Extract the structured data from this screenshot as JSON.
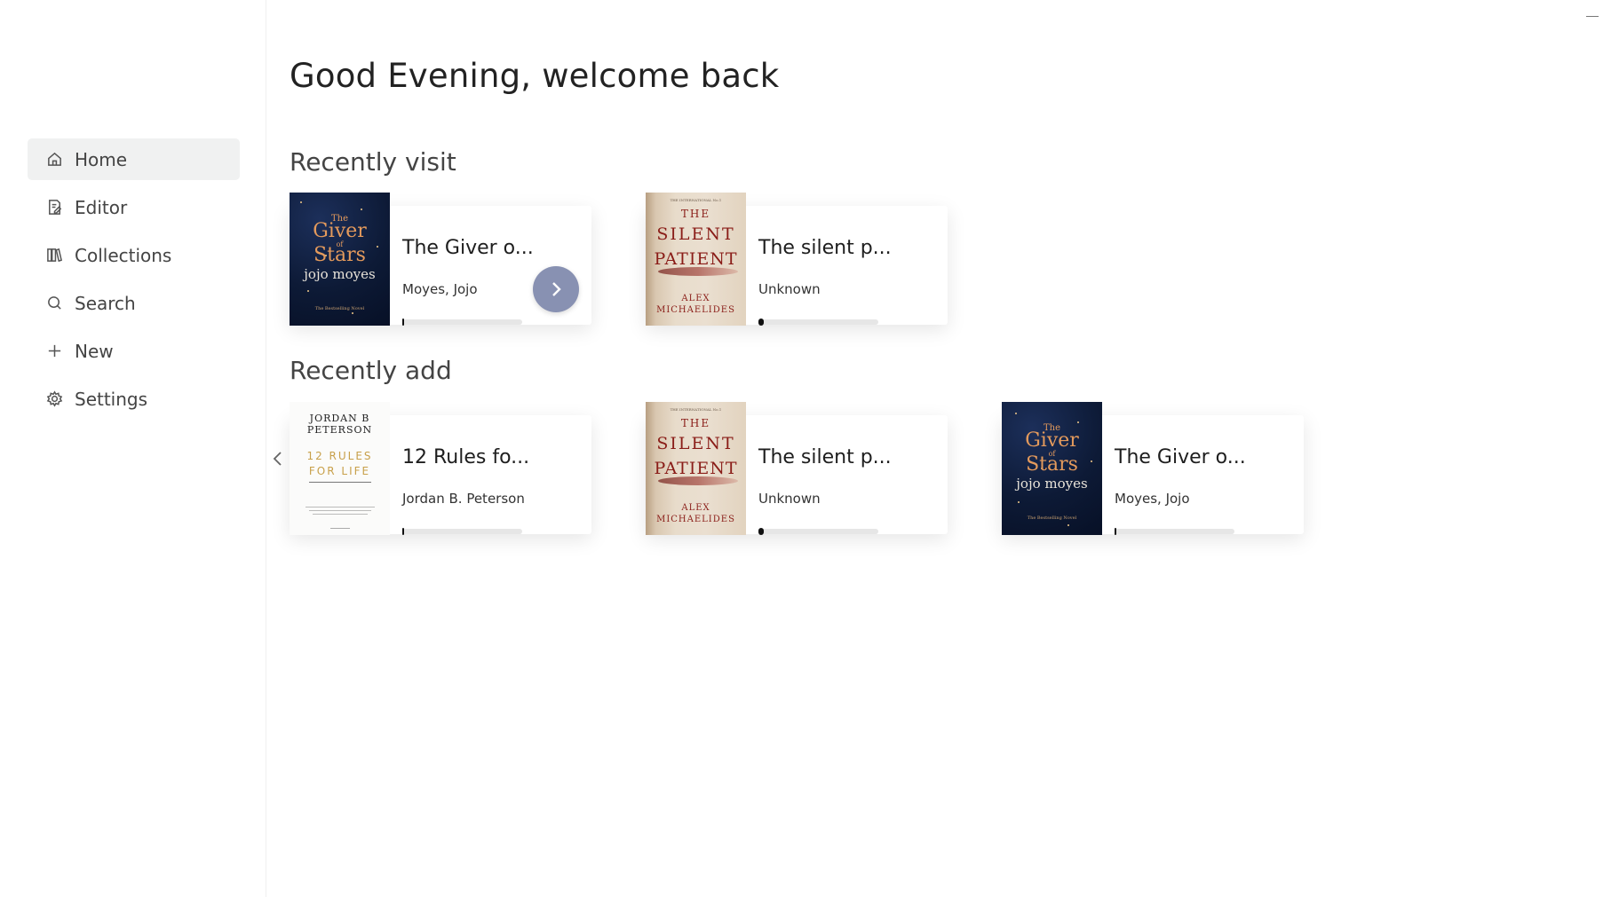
{
  "app": {
    "greeting": "Good Evening, welcome back"
  },
  "sidebar": {
    "items": [
      {
        "label": "Home",
        "icon": "home-icon",
        "active": true
      },
      {
        "label": "Editor",
        "icon": "editor-icon",
        "active": false
      },
      {
        "label": "Collections",
        "icon": "collections-icon",
        "active": false
      },
      {
        "label": "Search",
        "icon": "search-icon",
        "active": false
      },
      {
        "label": "New",
        "icon": "plus-icon",
        "active": false
      },
      {
        "label": "Settings",
        "icon": "gear-icon",
        "active": false
      }
    ]
  },
  "sections": {
    "recent_visit": {
      "title": "Recently visit",
      "books": [
        {
          "title": "The Giver o...",
          "author": "Moyes, Jojo",
          "progress": 0.01,
          "cover": "giver-of-stars"
        },
        {
          "title": "The silent p...",
          "author": "Unknown",
          "progress": 0.04,
          "cover": "silent-patient"
        }
      ]
    },
    "recent_add": {
      "title": "Recently add",
      "books": [
        {
          "title": "12 Rules fo...",
          "author": "Jordan B. Peterson",
          "progress": 0.0,
          "cover": "12-rules-for-life"
        },
        {
          "title": "The silent p...",
          "author": "Unknown",
          "progress": 0.04,
          "cover": "silent-patient"
        },
        {
          "title": "The Giver o...",
          "author": "Moyes, Jojo",
          "progress": 0.01,
          "cover": "giver-of-stars"
        }
      ]
    }
  },
  "covers": {
    "giver": {
      "top": "The",
      "word1": "Giver",
      "of": "of",
      "word2": "Stars",
      "author": "jojo moyes",
      "tagline": "The Bestselling Novel"
    },
    "silent": {
      "tag": "THE INTERNATIONAL No.1",
      "the": "THE",
      "line1": "SILENT",
      "line2": "PATIENT",
      "author1": "ALEX",
      "author2": "MICHAELIDES"
    },
    "rules": {
      "author1": "JORDAN B",
      "author2": "PETERSON",
      "title1": "12 RULES",
      "title2": "FOR LIFE"
    }
  },
  "colors": {
    "active_nav_bg": "#f0f1f1",
    "next_button": "#8891b2",
    "progress_fill": "#111111",
    "progress_track": "#e6e6e6"
  }
}
